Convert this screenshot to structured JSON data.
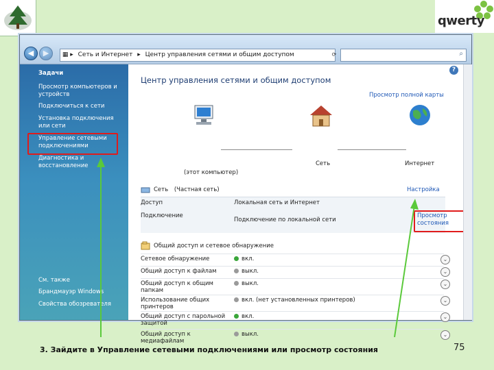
{
  "slide": {
    "logo_text": "qwerty",
    "instruction": "3. Зайдите в Управление сетевыми подключениями или просмотр состояния",
    "page_number": "75"
  },
  "window": {
    "breadcrumb": [
      "Сеть и Интернет",
      "Центр управления сетями и общим доступом"
    ]
  },
  "sidebar": {
    "heading": "Задачи",
    "items": [
      "Просмотр компьютеров и устройств",
      "Подключиться к сети",
      "Установка подключения или сети",
      "Управление сетевыми подключениями",
      "Диагностика и восстановление"
    ],
    "see_also_heading": "См. также",
    "see_also": [
      "Брандмауэр Windows",
      "Свойства обозревателя"
    ]
  },
  "main": {
    "title": "Центр управления сетями и общим доступом",
    "map_link": "Просмотр полной карты",
    "map_nodes": {
      "computer": "(этот компьютер)",
      "network": "Сеть",
      "internet": "Интернет"
    },
    "network_name": "Сеть",
    "network_type": "(Частная сеть)",
    "customize_link": "Настройка",
    "access_label": "Доступ",
    "access_value": "Локальная сеть и Интернет",
    "connection_label": "Подключение",
    "connection_value": "Подключение по локальной сети",
    "view_status_link": "Просмотр состояния",
    "sharing_heading": "Общий доступ и сетевое обнаружение",
    "sharing_rows": [
      {
        "label": "Сетевое обнаружение",
        "value": "вкл.",
        "dot": "#3aa63a"
      },
      {
        "label": "Общий доступ к файлам",
        "value": "выкл.",
        "dot": "#9a9a9a"
      },
      {
        "label": "Общий доступ к общим папкам",
        "value": "выкл.",
        "dot": "#9a9a9a"
      },
      {
        "label": "Использование общих принтеров",
        "value": "вкл. (нет установленных принтеров)",
        "dot": "#9a9a9a"
      },
      {
        "label": "Общий доступ с парольной защитой",
        "value": "вкл.",
        "dot": "#3aa63a"
      },
      {
        "label": "Общий доступ к медиафайлам",
        "value": "выкл.",
        "dot": "#9a9a9a"
      }
    ]
  }
}
